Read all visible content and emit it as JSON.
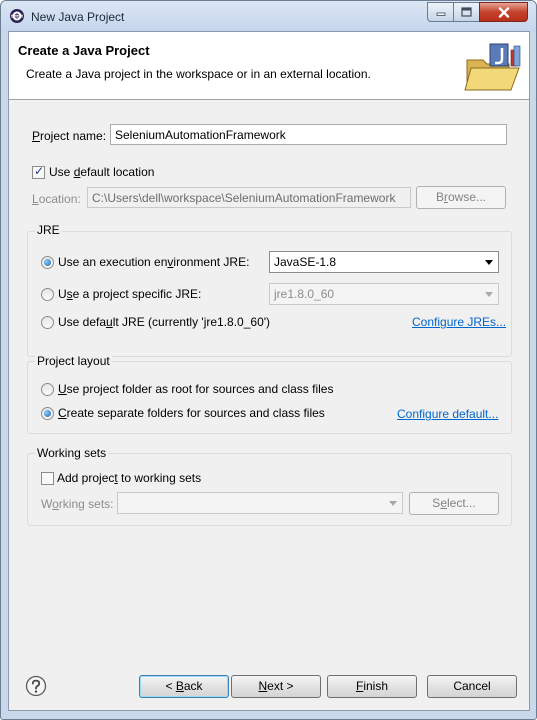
{
  "window": {
    "title": "New Java Project"
  },
  "banner": {
    "title": "Create a Java Project",
    "description": "Create a Java project in the workspace or in an external location."
  },
  "project": {
    "name_label_key": "P",
    "name_label_rest": "roject name:",
    "name_value": "SeleniumAutomationFramework",
    "use_default_location_pre": "Use ",
    "use_default_location_key": "d",
    "use_default_location_post": "efault location",
    "use_default_location_checked": true,
    "location_label_key": "L",
    "location_label_rest": "ocation:",
    "location_value": "C:\\Users\\dell\\workspace\\SeleniumAutomationFramework",
    "browse_label_pre": "B",
    "browse_label_key": "r",
    "browse_label_post": "owse..."
  },
  "jre": {
    "group_label": "JRE",
    "env_option_pre": "Use an execution en",
    "env_option_key": "v",
    "env_option_post": "ironment JRE:",
    "env_value": "JavaSE-1.8",
    "specific_option_pre": "U",
    "specific_option_key": "s",
    "specific_option_post": "e a project specific JRE:",
    "specific_value": "jre1.8.0_60",
    "default_option_pre": "Use defa",
    "default_option_key": "u",
    "default_option_post": "lt JRE (currently 'jre1.8.0_60')",
    "configure_link": "Configure JREs...",
    "selected": "env"
  },
  "layout": {
    "group_label": "Project layout",
    "root_option_pre": "",
    "root_option_key": "U",
    "root_option_post": "se project folder as root for sources and class files",
    "separate_option_pre": "",
    "separate_option_key": "C",
    "separate_option_post": "reate separate folders for sources and class files",
    "configure_link": "Configure default...",
    "selected": "separate"
  },
  "working_sets": {
    "group_label": "Working sets",
    "add_option_pre": "Add projec",
    "add_option_key": "t",
    "add_option_post": " to working sets",
    "add_checked": false,
    "label_pre": "W",
    "label_key": "o",
    "label_post": "rking sets:",
    "value": "",
    "select_label_pre": "S",
    "select_label_key": "e",
    "select_label_post": "lect..."
  },
  "footer": {
    "back_pre": "< ",
    "back_key": "B",
    "back_post": "ack",
    "next_pre": "",
    "next_key": "N",
    "next_post": "ext >",
    "finish_pre": "",
    "finish_key": "F",
    "finish_post": "inish",
    "cancel_label": "Cancel"
  },
  "colors": {
    "link": "#0066cc",
    "banner_bg": "#ffffff",
    "dialog_bg": "#f0f0f0",
    "close_button": "#c4422d"
  },
  "icons": [
    "eclipse-app-icon",
    "minimize-icon",
    "maximize-icon",
    "close-icon",
    "java-project-folder-icon",
    "help-icon"
  ]
}
